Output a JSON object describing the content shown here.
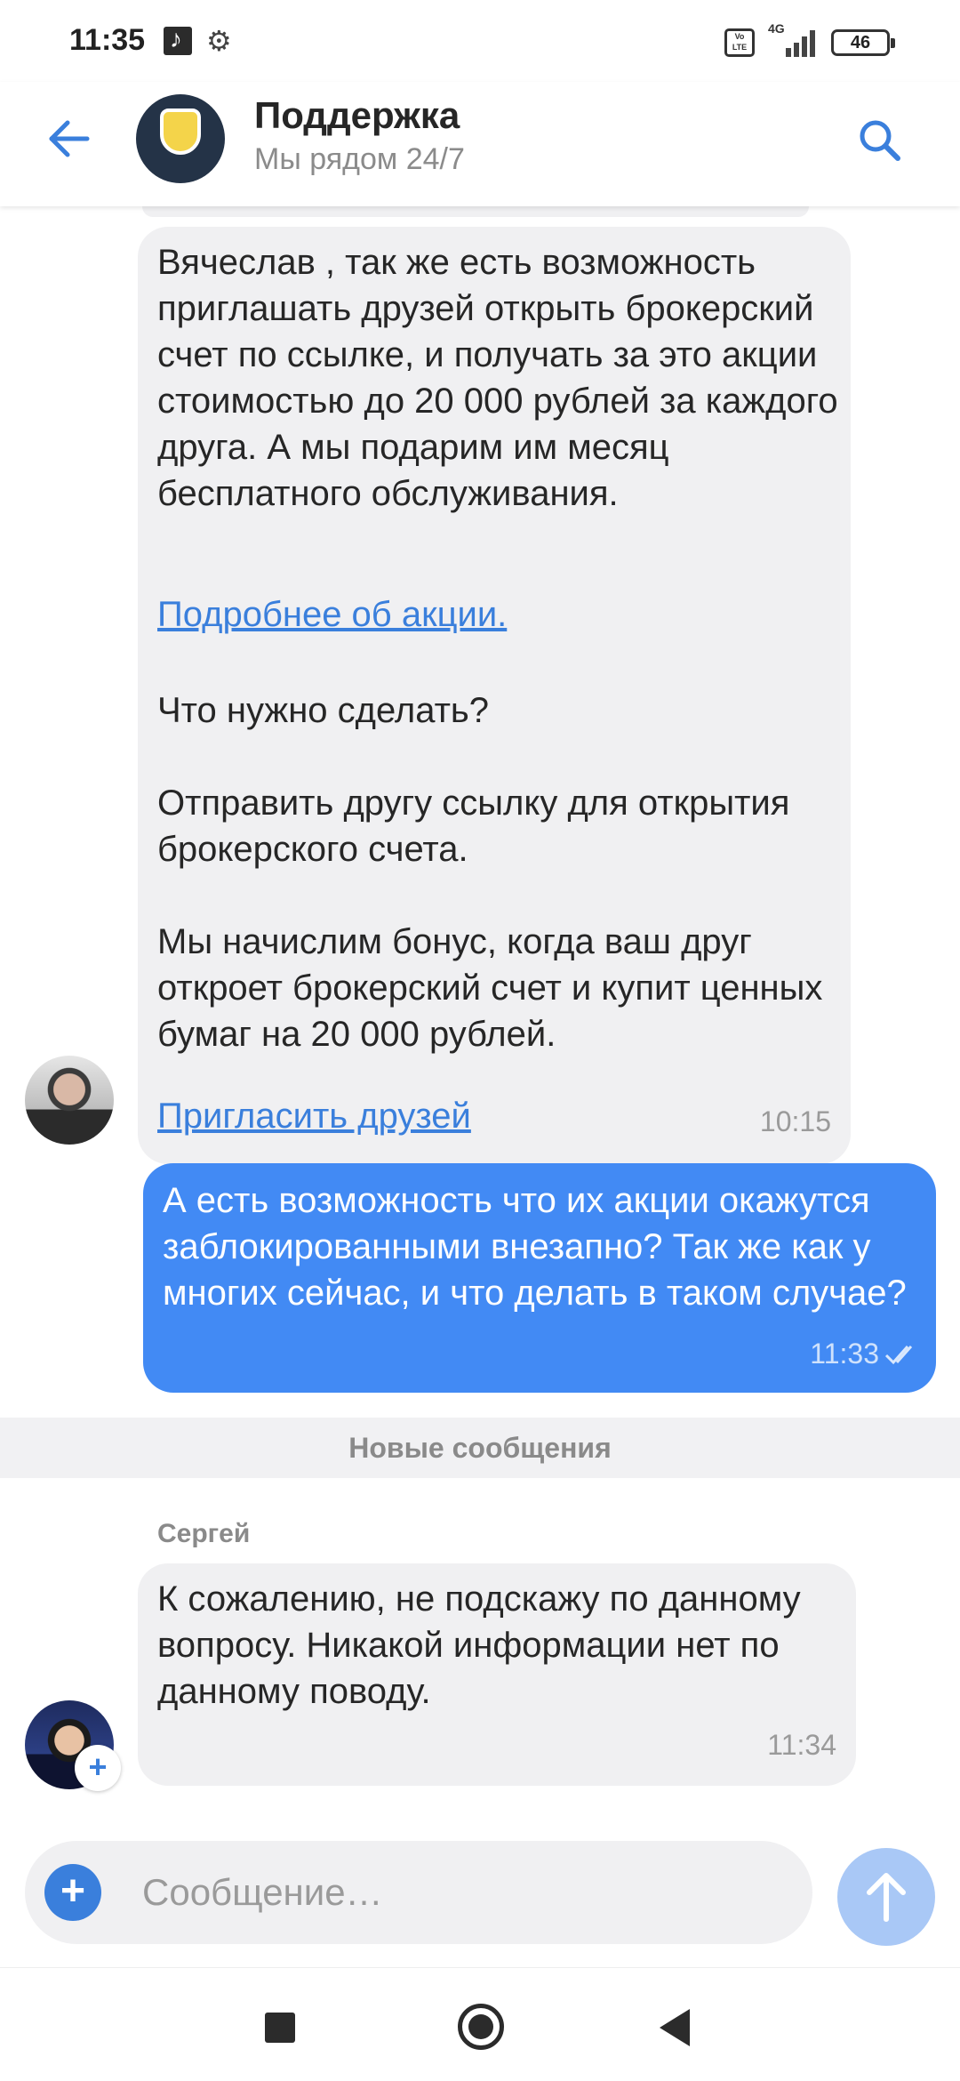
{
  "status_bar": {
    "time": "11:35",
    "volte_label": "Vo LTE",
    "network": "4G",
    "battery": "46"
  },
  "header": {
    "title": "Поддержка",
    "subtitle": "Мы рядом 24/7"
  },
  "messages": {
    "m1": {
      "text": "Вячеслав , так же есть возможность приглашать друзей открыть брокерский счет по ссылке, и получать за это акции стоимостью до 20 000 рублей за каждого друга. А мы подарим им месяц бесплатного обслуживания.",
      "link1": "Подробнее об акции.",
      "text2": "Что нужно сделать?\n\nОтправить другу ссылку для открытия брокерского счета.\n\nМы начислим бонус, когда ваш друг откроет брокерский счет и купит ценных бумаг на 20 000 рублей.",
      "link2": "Пригласить друзей",
      "time": "10:15"
    },
    "m2": {
      "text": "А есть возможность что их акции окажутся заблокированными внезапно? Так же как у многих сейчас, и что делать в таком случае?",
      "time": "11:33"
    },
    "divider": "Новые сообщения",
    "m3": {
      "sender": "Сергей",
      "text": "К сожалению, не подскажу по данному вопросу. Никакой информации нет по данному поводу.",
      "time": "11:34"
    }
  },
  "composer": {
    "placeholder": "Сообщение…"
  },
  "colors": {
    "accent": "#3a7fdc",
    "outgoing_bubble": "#428af4",
    "incoming_bubble": "#f0f0f2"
  }
}
